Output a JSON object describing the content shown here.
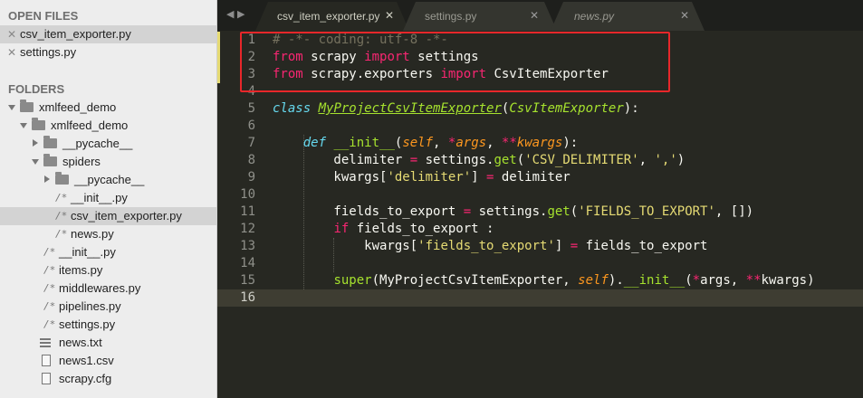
{
  "sidebar": {
    "open_files_heading": "OPEN FILES",
    "open_files": [
      {
        "name": "csv_item_exporter.py",
        "selected": true
      },
      {
        "name": "settings.py",
        "selected": false
      }
    ],
    "folders_heading": "FOLDERS",
    "tree": [
      {
        "name": "xmlfeed_demo",
        "kind": "folder",
        "expanded": true,
        "depth": 0
      },
      {
        "name": "xmlfeed_demo",
        "kind": "folder",
        "expanded": true,
        "depth": 1
      },
      {
        "name": "__pycache__",
        "kind": "folder",
        "expanded": false,
        "depth": 2
      },
      {
        "name": "spiders",
        "kind": "folder",
        "expanded": true,
        "depth": 2
      },
      {
        "name": "__pycache__",
        "kind": "folder",
        "expanded": false,
        "depth": 3
      },
      {
        "name": "__init__.py",
        "kind": "py",
        "depth": 3
      },
      {
        "name": "csv_item_exporter.py",
        "kind": "py",
        "depth": 3,
        "selected": true
      },
      {
        "name": "news.py",
        "kind": "py",
        "depth": 3
      },
      {
        "name": "__init__.py",
        "kind": "py",
        "depth": 2
      },
      {
        "name": "items.py",
        "kind": "py",
        "depth": 2
      },
      {
        "name": "middlewares.py",
        "kind": "py",
        "depth": 2
      },
      {
        "name": "pipelines.py",
        "kind": "py",
        "depth": 2
      },
      {
        "name": "settings.py",
        "kind": "py",
        "depth": 2
      },
      {
        "name": "news.txt",
        "kind": "txt",
        "depth": 1
      },
      {
        "name": "news1.csv",
        "kind": "doc",
        "depth": 1
      },
      {
        "name": "scrapy.cfg",
        "kind": "doc",
        "depth": 1
      }
    ]
  },
  "tabs": [
    {
      "label": "csv_item_exporter.py",
      "active": true
    },
    {
      "label": "settings.py",
      "active": false
    },
    {
      "label": "news.py",
      "active": false
    }
  ],
  "icons": {
    "nav_prev": "triangle-left-icon",
    "nav_next": "triangle-right-icon",
    "tab_close": "close-icon",
    "py_file": "python-file-icon"
  },
  "colors": {
    "highlight_box": "#e8272a",
    "keyword": "#f92672",
    "function": "#a6e22e",
    "string": "#e6db74",
    "storage": "#66d9ef",
    "param": "#fd971f",
    "comment": "#75715e",
    "background": "#272822"
  },
  "editor": {
    "current_line": 16,
    "modified_lines": [
      1,
      2,
      3
    ],
    "highlighted_lines": [
      1,
      2,
      3
    ],
    "lines": [
      {
        "num": "1",
        "tokens": [
          [
            "cm",
            "# -*- coding: utf-8 -*-"
          ]
        ]
      },
      {
        "num": "2",
        "tokens": [
          [
            "kw",
            "from"
          ],
          [
            "",
            " scrapy "
          ],
          [
            "kw",
            "import"
          ],
          [
            "",
            " settings"
          ]
        ]
      },
      {
        "num": "3",
        "tokens": [
          [
            "kw",
            "from"
          ],
          [
            "",
            " scrapy.exporters "
          ],
          [
            "kw",
            "import"
          ],
          [
            "",
            " CsvItemExporter"
          ]
        ]
      },
      {
        "num": "4",
        "tokens": []
      },
      {
        "num": "5",
        "tokens": [
          [
            "st",
            "class"
          ],
          [
            "",
            " "
          ],
          [
            "cls",
            "MyProjectCsvItemExporter"
          ],
          [
            "",
            "("
          ],
          [
            "base",
            "CsvItemExporter"
          ],
          [
            "",
            "):"
          ]
        ]
      },
      {
        "num": "6",
        "tokens": []
      },
      {
        "num": "7",
        "tokens": [
          [
            "",
            "    "
          ],
          [
            "st",
            "def"
          ],
          [
            "",
            " "
          ],
          [
            "fn",
            "__init__"
          ],
          [
            "",
            "("
          ],
          [
            "self",
            "self"
          ],
          [
            "",
            ", "
          ],
          [
            "kw",
            "*"
          ],
          [
            "self",
            "args"
          ],
          [
            "",
            ", "
          ],
          [
            "kw",
            "**"
          ],
          [
            "self",
            "kwargs"
          ],
          [
            "",
            "):"
          ]
        ]
      },
      {
        "num": "8",
        "tokens": [
          [
            "",
            "        delimiter "
          ],
          [
            "kw",
            "="
          ],
          [
            "",
            " settings."
          ],
          [
            "dk",
            "get"
          ],
          [
            "",
            "("
          ],
          [
            "str",
            "'CSV_DELIMITER'"
          ],
          [
            "",
            ", "
          ],
          [
            "str",
            "','"
          ],
          [
            "",
            ")"
          ]
        ]
      },
      {
        "num": "9",
        "tokens": [
          [
            "",
            "        kwargs["
          ],
          [
            "str",
            "'delimiter'"
          ],
          [
            "",
            "] "
          ],
          [
            "kw",
            "="
          ],
          [
            "",
            " delimiter"
          ]
        ]
      },
      {
        "num": "10",
        "tokens": []
      },
      {
        "num": "11",
        "tokens": [
          [
            "",
            "        fields_to_export "
          ],
          [
            "kw",
            "="
          ],
          [
            "",
            " settings."
          ],
          [
            "dk",
            "get"
          ],
          [
            "",
            "("
          ],
          [
            "str",
            "'FIELDS_TO_EXPORT'"
          ],
          [
            "",
            ", [])"
          ]
        ]
      },
      {
        "num": "12",
        "tokens": [
          [
            "",
            "        "
          ],
          [
            "kw",
            "if"
          ],
          [
            "",
            " fields_to_export :"
          ]
        ]
      },
      {
        "num": "13",
        "tokens": [
          [
            "",
            "            kwargs["
          ],
          [
            "str",
            "'fields_to_export'"
          ],
          [
            "",
            "] "
          ],
          [
            "kw",
            "="
          ],
          [
            "",
            " fields_to_export"
          ]
        ]
      },
      {
        "num": "14",
        "tokens": []
      },
      {
        "num": "15",
        "tokens": [
          [
            "",
            "        "
          ],
          [
            "dk",
            "super"
          ],
          [
            "",
            "(MyProjectCsvItemExporter, "
          ],
          [
            "self",
            "self"
          ],
          [
            "",
            ")."
          ],
          [
            "fn",
            "__init__"
          ],
          [
            "",
            "("
          ],
          [
            "kw",
            "*"
          ],
          [
            "",
            "args, "
          ],
          [
            "kw",
            "**"
          ],
          [
            "",
            "kwargs)"
          ]
        ]
      },
      {
        "num": "16",
        "tokens": []
      }
    ]
  }
}
